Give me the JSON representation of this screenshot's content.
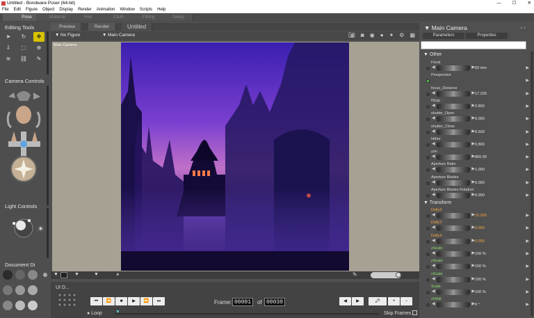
{
  "window": {
    "title": "Untitled - Bondware Poser (64-bit)",
    "minimize": "—",
    "maximize": "☐",
    "close": "✕"
  },
  "menu": [
    "File",
    "Edit",
    "Figure",
    "Object",
    "Display",
    "Render",
    "Animation",
    "Window",
    "Scripts",
    "Help"
  ],
  "rooms": [
    "Pose",
    "Material",
    "Hair",
    "Cloth",
    "Fitting",
    "Setup"
  ],
  "left": {
    "editing_tools": "Editing Tools",
    "camera_controls": "Camera Controls",
    "light_controls": "Light Controls",
    "document_display": "Document  Di"
  },
  "center": {
    "doc_title": "Untitled",
    "tab_preview": "Preview",
    "tab_render": "Render",
    "figure_select": "No Figure",
    "camera_select": "Main Camera",
    "viewport_label": "Main Camera"
  },
  "timeline": {
    "ui_label": "UI D...",
    "frame_label": "Frame:",
    "current_frame": "00001",
    "of_label": "of",
    "total_frames": "00030",
    "loop_label": "Loop",
    "skip_label": "Skip Frames"
  },
  "right": {
    "title": "Main Camera",
    "tab_parameters": "Parameters",
    "tab_properties": "Properties",
    "group_other": "Other",
    "group_transform": "Transform",
    "params_other": [
      {
        "name": "Focal",
        "value": "50 mm"
      },
      {
        "name": "Perspective",
        "value": ""
      },
      {
        "name": "focus_Distance",
        "value": "17.200"
      },
      {
        "name": "fStop",
        "value": "2.800"
      },
      {
        "name": "shutter_Open",
        "value": "0.000"
      },
      {
        "name": "shutter_Close",
        "value": "0.500"
      },
      {
        "name": "hither",
        "value": "0.800"
      },
      {
        "name": "yon",
        "value": "860.00"
      },
      {
        "name": "Aperture Ratio",
        "value": "1.000"
      },
      {
        "name": "Aperture Blades",
        "value": "0.000"
      },
      {
        "name": "Aperture Blades Rotation",
        "value": "0.000"
      }
    ],
    "params_transform": [
      {
        "name": "DollyZ",
        "value": "15.000"
      },
      {
        "name": "DollyY",
        "value": "3.000"
      },
      {
        "name": "DollyX",
        "value": "0.000"
      },
      {
        "name": "zScale",
        "value": "100 %"
      },
      {
        "name": "yScale",
        "value": "100 %"
      },
      {
        "name": "xScale",
        "value": "100 %"
      },
      {
        "name": "Scale",
        "value": "100 %"
      },
      {
        "name": "zOrbit",
        "value": "0 °"
      }
    ]
  },
  "colors": {
    "accent_yellow": "#d8c200",
    "orange_param": "#f4a640",
    "green_param": "#8fe070",
    "radio_on": "#59d359"
  }
}
